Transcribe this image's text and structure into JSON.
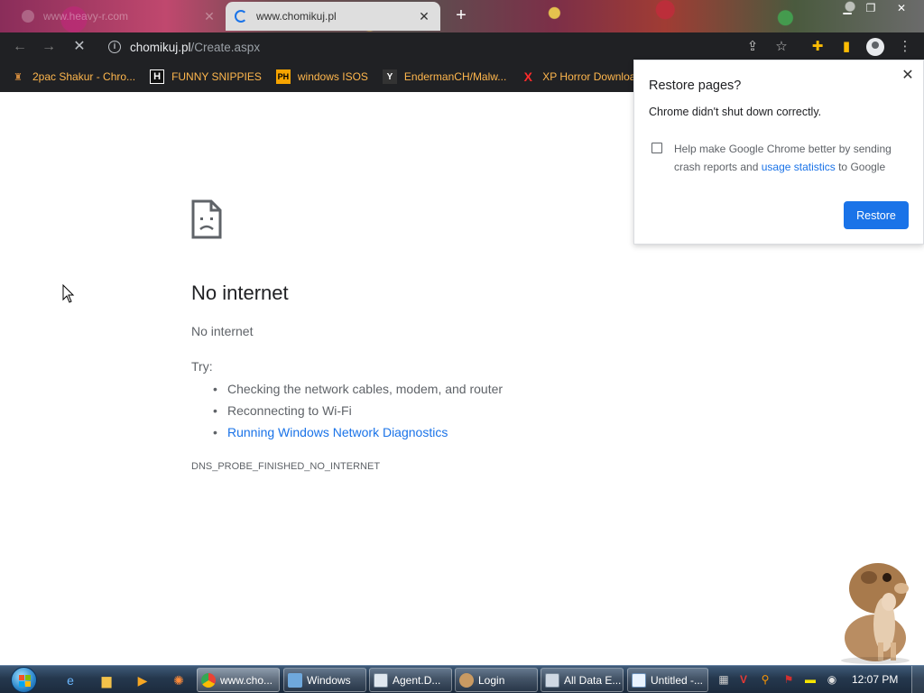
{
  "tabs": [
    {
      "title": "www.heavy-r.com",
      "active": false
    },
    {
      "title": "www.chomikuj.pl",
      "active": true
    }
  ],
  "toolbar": {
    "url_host": "chomikuj.pl",
    "url_path": "/Create.aspx",
    "icons": [
      "back-arrow-icon",
      "forward-arrow-icon",
      "stop-loading-icon",
      "info-icon",
      "share-icon",
      "bookmark-star-icon",
      "extensions-puzzle-icon",
      "side-panel-icon",
      "profile-avatar-icon",
      "menu-kebab-icon"
    ]
  },
  "bookmarks": [
    {
      "label": "2pac Shakur - Chro...",
      "icon": "figure-icon",
      "color": "#d08a3e"
    },
    {
      "label": "FUNNY SNIPPIES",
      "icon": "H",
      "color": "#ffffff"
    },
    {
      "label": "windows ISOS",
      "icon": "PH",
      "color": "#f7a400"
    },
    {
      "label": "EndermanCH/Malw...",
      "icon": "Y",
      "color": "#ffffff"
    },
    {
      "label": "XP Horror Download",
      "icon": "X",
      "color": "#ff2b2b"
    }
  ],
  "error_page": {
    "heading": "No internet",
    "subheading": "No internet",
    "try_label": "Try:",
    "suggestions": [
      "Checking the network cables, modem, and router",
      "Reconnecting to Wi-Fi",
      "Running Windows Network Diagnostics"
    ],
    "error_code": "DNS_PROBE_FINISHED_NO_INTERNET"
  },
  "restore_popup": {
    "title": "Restore pages?",
    "message": "Chrome didn't shut down correctly.",
    "help_text_before": "Help make Google Chrome better by sending crash reports and ",
    "help_link": "usage statistics",
    "help_text_after": " to Google",
    "checkbox_checked": false,
    "button_label": "Restore",
    "close_glyph": "✕"
  },
  "taskbar": {
    "tasks": [
      {
        "label": "www.cho...",
        "icon": "chrome-icon",
        "active": true
      },
      {
        "label": "Windows",
        "icon": "windows-update-icon",
        "active": false
      },
      {
        "label": "Agent.D...",
        "icon": "app-window-icon",
        "active": false
      },
      {
        "label": "Login",
        "icon": "login-icon",
        "active": false
      },
      {
        "label": "All Data E...",
        "icon": "folder-window-icon",
        "active": false
      },
      {
        "label": "Untitled -...",
        "icon": "notepad-icon",
        "active": false
      }
    ],
    "clock": "12:07 PM"
  },
  "colors": {
    "accent": "#1a73e8",
    "toolbar_bg": "#202124",
    "bookmark_text": "#ffb74d"
  }
}
